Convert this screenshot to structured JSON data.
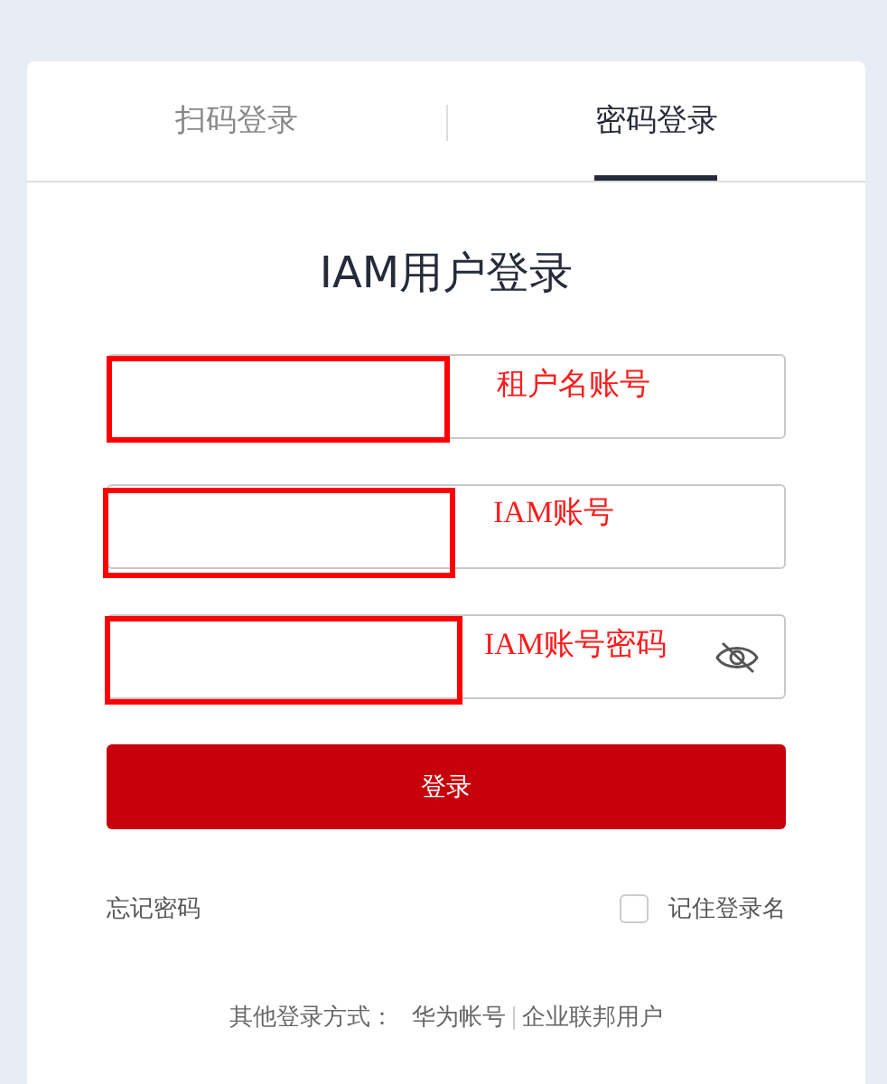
{
  "tabs": [
    {
      "label": "扫码登录",
      "selected": false
    },
    {
      "label": "密码登录",
      "selected": true
    }
  ],
  "title": "IAM用户登录",
  "fields": [
    {
      "kind": "text",
      "annotation": "租户名账号"
    },
    {
      "kind": "text",
      "annotation": "IAM账号"
    },
    {
      "kind": "password",
      "annotation": "IAM账号密码"
    }
  ],
  "login_button": "登录",
  "forgot_password": "忘记密码",
  "remember": {
    "label": "记住登录名",
    "checked": false
  },
  "other_login": {
    "label": "其他登录方式：",
    "links": [
      "华为帐号",
      "企业联邦用户"
    ]
  }
}
